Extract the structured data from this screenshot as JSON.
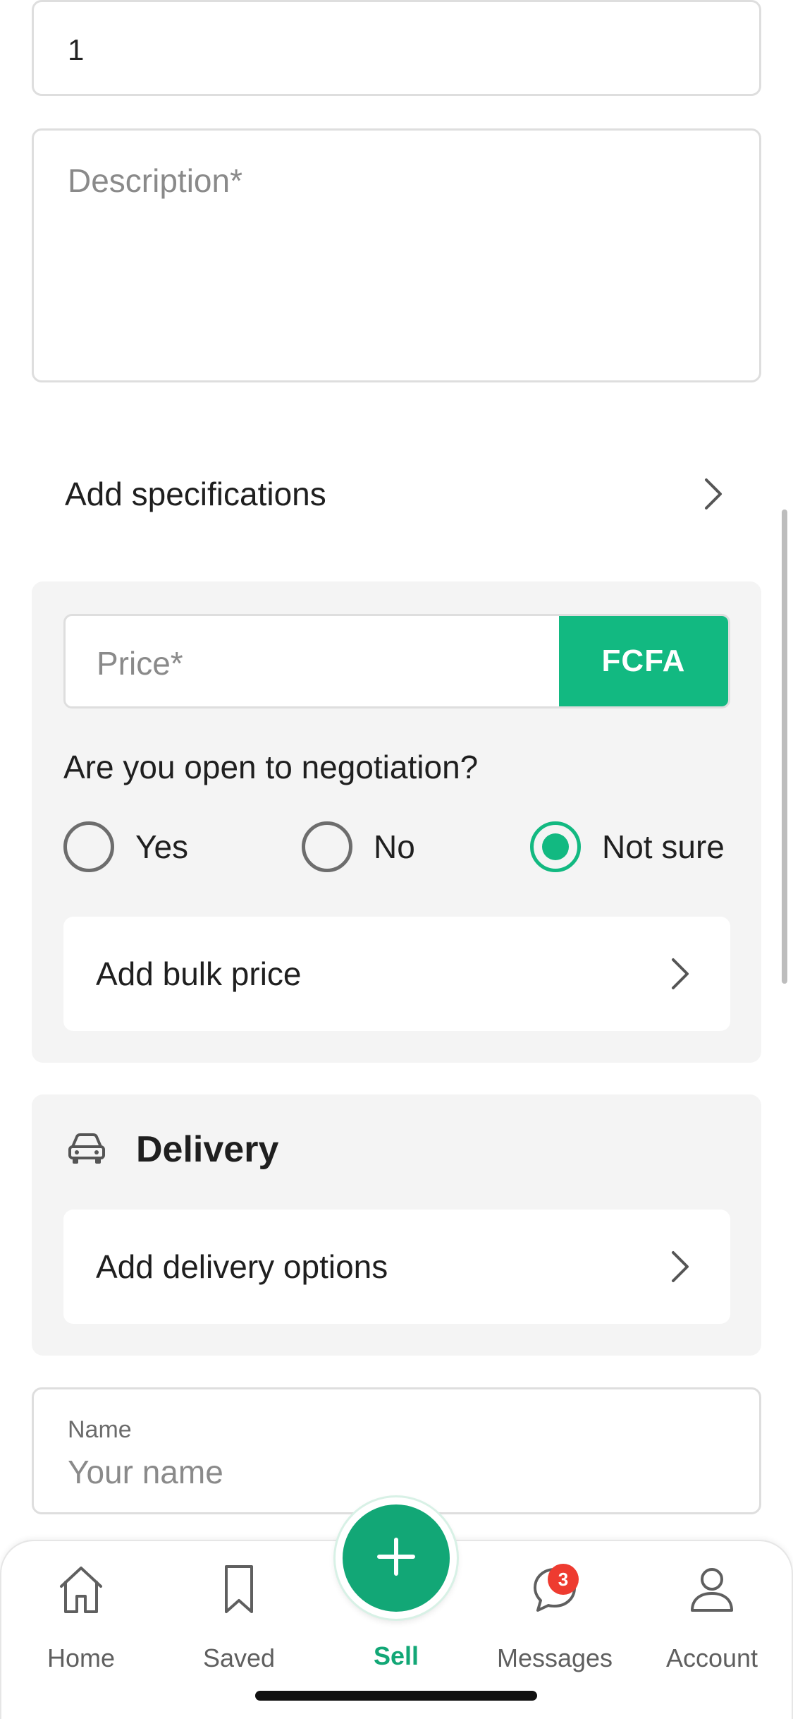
{
  "title_field": {
    "value": "1"
  },
  "description_field": {
    "placeholder": "Description*"
  },
  "specifications": {
    "label": "Add specifications"
  },
  "price": {
    "placeholder": "Price*",
    "currency": "FCFA",
    "question": "Are you open to negotiation?",
    "options": [
      {
        "label": "Yes",
        "selected": false
      },
      {
        "label": "No",
        "selected": false
      },
      {
        "label": "Not sure",
        "selected": true
      }
    ],
    "bulk_label": "Add bulk price"
  },
  "delivery": {
    "icon": "car-icon",
    "title": "Delivery",
    "options_label": "Add delivery options"
  },
  "name_field": {
    "label": "Name",
    "placeholder": "Your name"
  },
  "tabbar": {
    "home": "Home",
    "saved": "Saved",
    "sell": "Sell",
    "messages": "Messages",
    "messages_badge": "3",
    "account": "Account"
  },
  "colors": {
    "accent": "#12b981",
    "sell": "#12a776",
    "badge": "#ee3b30"
  }
}
